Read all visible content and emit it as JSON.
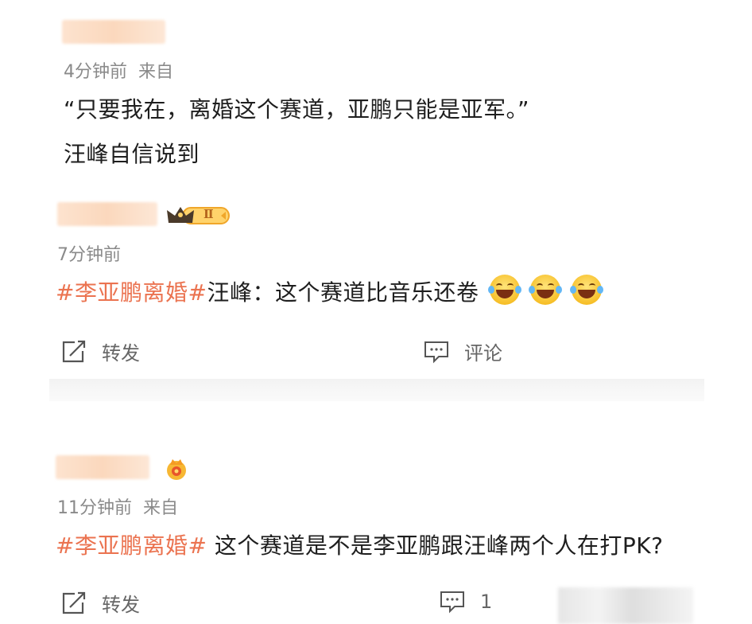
{
  "posts": [
    {
      "meta": {
        "time": "4分钟前",
        "source": "来自"
      },
      "lines": [
        "“只要我在，离婚这个赛道，亚鹏只能是亚军。”",
        "汪峰自信说到"
      ]
    },
    {
      "meta": {
        "time": "7分钟前"
      },
      "badge_text": "Ⅱ",
      "hashtag": "#李亚鹏离婚#",
      "text": "汪峰：这个赛道比音乐还卷",
      "emoji_icon": "laughing-tears-icon",
      "actions": {
        "repost": "转发",
        "comment": "评论"
      }
    },
    {
      "meta": {
        "time": "11分钟前",
        "source": "来自"
      },
      "hashtag": "#李亚鹏离婚#",
      "text": " 这个赛道是不是李亚鹏跟汪峰两个人在打PK?",
      "actions": {
        "repost": "转发",
        "comment_count": "1"
      }
    }
  ],
  "colors": {
    "hashtag": "#eb7350",
    "meta": "#8a8a8a",
    "crown": "#f5a623"
  }
}
